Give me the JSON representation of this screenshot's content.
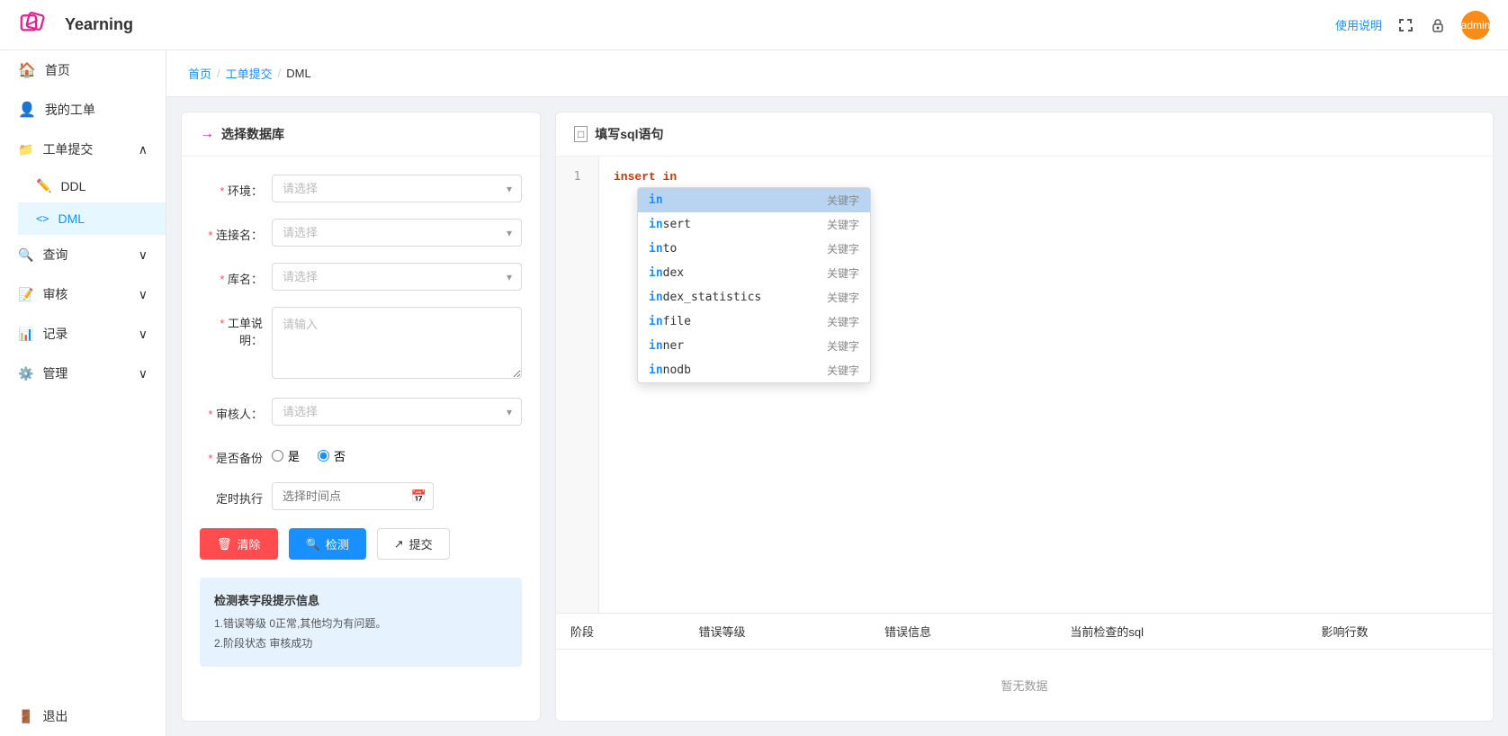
{
  "app": {
    "name": "Yearning",
    "help_link": "使用说明",
    "avatar_text": "admin"
  },
  "breadcrumb": {
    "items": [
      "首页",
      "工单提交",
      "DML"
    ]
  },
  "sidebar": {
    "items": [
      {
        "id": "home",
        "label": "首页",
        "icon": "🏠"
      },
      {
        "id": "my-orders",
        "label": "我的工单",
        "icon": "👤"
      }
    ],
    "groups": [
      {
        "id": "order-submit",
        "label": "工单提交",
        "icon": "📁",
        "expanded": true,
        "children": [
          {
            "id": "ddl",
            "label": "DDL",
            "icon": "✏️"
          },
          {
            "id": "dml",
            "label": "DML",
            "icon": "<>",
            "active": true
          }
        ]
      },
      {
        "id": "query",
        "label": "查询",
        "icon": "🔍",
        "expanded": false,
        "children": []
      },
      {
        "id": "audit",
        "label": "审核",
        "icon": "📝",
        "expanded": false,
        "children": []
      },
      {
        "id": "records",
        "label": "记录",
        "icon": "📊",
        "expanded": false,
        "children": []
      },
      {
        "id": "management",
        "label": "管理",
        "icon": "⚙️",
        "expanded": false,
        "children": []
      }
    ],
    "logout": {
      "label": "退出",
      "icon": "🚪"
    }
  },
  "left_panel": {
    "title": "选择数据库",
    "title_icon": "→",
    "fields": {
      "env_label": "环境：",
      "env_placeholder": "请选择",
      "connection_label": "连接名：",
      "connection_placeholder": "请选择",
      "database_label": "库名：",
      "database_placeholder": "请选择",
      "description_label": "工单说明：",
      "description_placeholder": "请输入",
      "reviewer_label": "审核人：",
      "reviewer_placeholder": "请选择",
      "backup_label": "是否备份",
      "backup_yes": "是",
      "backup_no": "否",
      "schedule_label": "定时执行",
      "schedule_placeholder": "选择时间点"
    },
    "buttons": {
      "clear": "清除",
      "detect": "检测",
      "submit": "提交"
    },
    "info_box": {
      "title": "检测表字段提示信息",
      "lines": [
        "1.错误等级 0正常,其他均为有问题。",
        "",
        "2.阶段状态 审核成功"
      ]
    }
  },
  "right_panel": {
    "title": "填写sql语句",
    "title_icon": "□",
    "editor": {
      "line_number": "1",
      "content": "insert in",
      "typed_text": "insert in"
    },
    "autocomplete": {
      "items": [
        {
          "match": "in",
          "rest": "",
          "full": "in",
          "type": "关键字",
          "selected": true
        },
        {
          "match": "in",
          "rest": "sert",
          "full": "insert",
          "type": "关键字",
          "selected": false
        },
        {
          "match": "in",
          "rest": "to",
          "full": "into",
          "type": "关键字",
          "selected": false
        },
        {
          "match": "in",
          "rest": "dex",
          "full": "index",
          "type": "关键字",
          "selected": false
        },
        {
          "match": "in",
          "rest": "dex_statistics",
          "full": "index_statistics",
          "type": "关键字",
          "selected": false
        },
        {
          "match": "in",
          "rest": "file",
          "full": "infile",
          "type": "关键字",
          "selected": false
        },
        {
          "match": "in",
          "rest": "ner",
          "full": "inner",
          "type": "关键字",
          "selected": false
        },
        {
          "match": "in",
          "rest": "nodb",
          "full": "innodb",
          "type": "关键字",
          "selected": false
        }
      ]
    },
    "table": {
      "columns": [
        "阶段",
        "错误等级",
        "错误信息",
        "当前检查的sql",
        "影响行数"
      ],
      "empty_text": "暂无数据"
    }
  }
}
